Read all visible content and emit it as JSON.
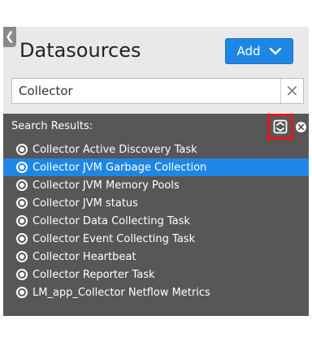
{
  "panel": {
    "collapse_glyph": "❮",
    "title": "Datasources",
    "add_label": "Add"
  },
  "search": {
    "value": "Collector",
    "clear_glyph": "✕"
  },
  "results": {
    "label": "Search Results:",
    "items": [
      {
        "label": "Collector Active Discovery Task"
      },
      {
        "label": "Collector JVM Garbage Collection",
        "selected": true
      },
      {
        "label": "Collector JVM Memory Pools"
      },
      {
        "label": "Collector JVM status"
      },
      {
        "label": "Collector Data Collecting Task"
      },
      {
        "label": "Collector Event Collecting Task"
      },
      {
        "label": "Collector Heartbeat"
      },
      {
        "label": "Collector Reporter Task"
      },
      {
        "label": "LM_app_Collector Netflow Metrics"
      }
    ]
  },
  "colors": {
    "accent": "#1e87e5",
    "results_bg": "#575757",
    "highlight": "#e8141c"
  }
}
